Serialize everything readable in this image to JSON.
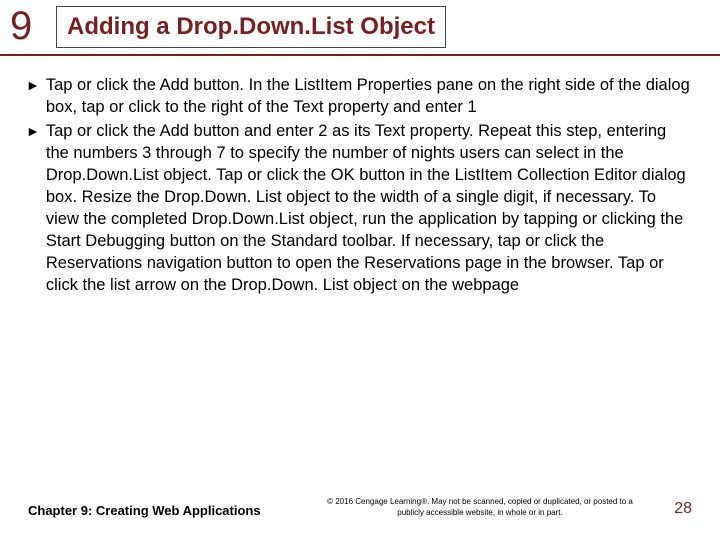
{
  "header": {
    "chapter_number": "9",
    "title": "Adding a Drop.Down.List Object"
  },
  "bullets": [
    "Tap or click the Add button. In the ListItem Properties pane on the right side of the dialog box, tap or click to the right of the Text property and enter 1",
    "Tap or click the Add button and enter 2 as its Text property. Repeat this step, entering the numbers 3 through 7 to specify the number of nights users can select in the Drop.Down.List object. Tap or click the OK button in the ListItem Collection Editor dialog box. Resize the Drop.Down. List object to the width of a single digit, if necessary. To view the completed Drop.Down.List object, run the application by tapping or clicking the Start Debugging button on the Standard toolbar. If necessary, tap or click the Reservations navigation button to open the Reservations page in the browser. Tap or click the list arrow on the Drop.Down. List object on the webpage"
  ],
  "footer": {
    "left": "Chapter 9: Creating Web Applications",
    "copyright": "© 2016 Cengage Learning®. May not be scanned, copied or duplicated, or posted to a publicly accessible website, in whole or in part.",
    "page": "28"
  }
}
